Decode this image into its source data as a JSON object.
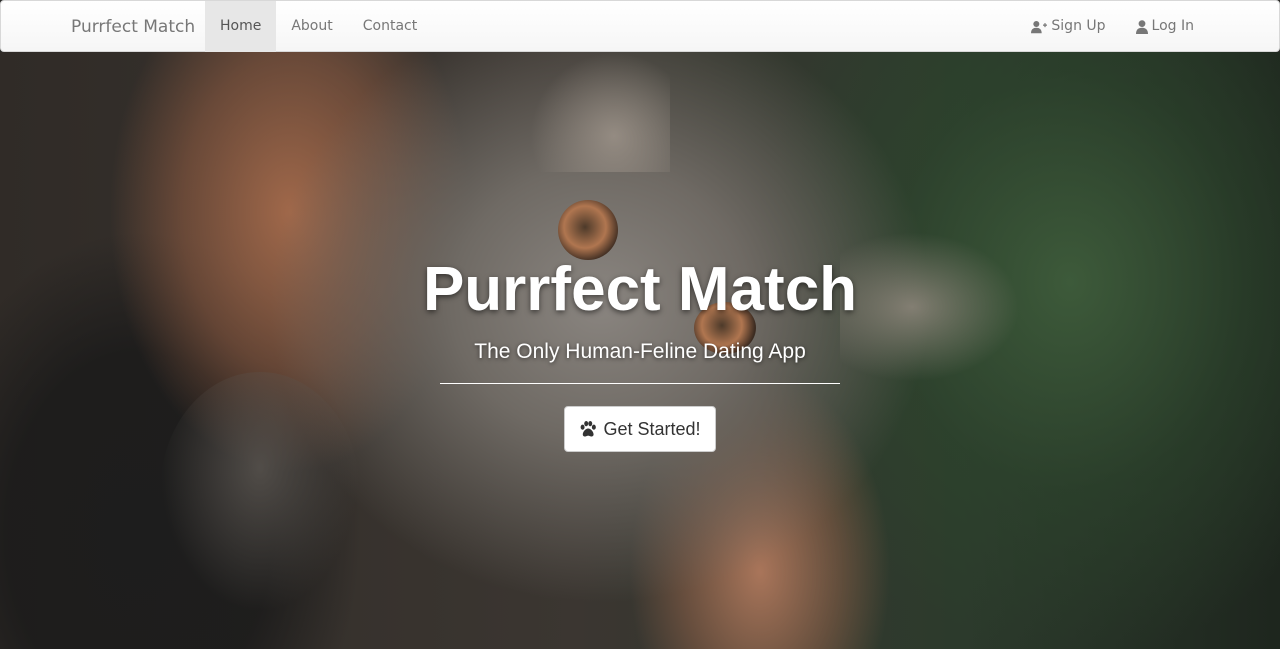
{
  "navbar": {
    "brand": "Purrfect Match",
    "left_items": [
      "Home",
      "About",
      "Contact"
    ],
    "active_item": "Home",
    "right_items": [
      {
        "label": "Sign Up",
        "icon": "user-plus-icon"
      },
      {
        "label": "Log In",
        "icon": "user-icon"
      }
    ]
  },
  "hero": {
    "title": "Purrfect Match",
    "subtitle": "The Only Human-Feline Dating App",
    "cta_label": "Get Started!",
    "cta_icon": "paw-icon",
    "background": "cat-photo"
  },
  "colors": {
    "nav_text": "#777777",
    "nav_active_bg": "#e7e7e7",
    "hero_text": "#ffffff",
    "button_text": "#333333"
  }
}
